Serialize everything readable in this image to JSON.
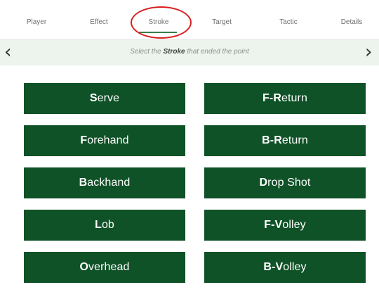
{
  "tabs": [
    {
      "label": "Player"
    },
    {
      "label": "Effect"
    },
    {
      "label": "Stroke"
    },
    {
      "label": "Target"
    },
    {
      "label": "Tactic"
    },
    {
      "label": "Details"
    }
  ],
  "active_tab": "Stroke",
  "instruction": {
    "prefix": "Select the ",
    "emphasis": "Stroke",
    "suffix": " that ended the point"
  },
  "nav": {
    "prev": "‹",
    "next": "›"
  },
  "strokes": [
    {
      "bold": "S",
      "rest": "erve"
    },
    {
      "bold": "F-R",
      "rest": "eturn"
    },
    {
      "bold": "F",
      "rest": "orehand"
    },
    {
      "bold": "B-R",
      "rest": "eturn"
    },
    {
      "bold": "B",
      "rest": "ackhand"
    },
    {
      "bold": "D",
      "rest": "rop Shot"
    },
    {
      "bold": "L",
      "rest": "ob"
    },
    {
      "bold": "F-V",
      "rest": "olley"
    },
    {
      "bold": "O",
      "rest": "verhead"
    },
    {
      "bold": "B-V",
      "rest": "olley"
    }
  ],
  "colors": {
    "button_bg": "#0f5227",
    "accent": "#3b7d4a",
    "highlight_ring": "#d81e1e",
    "instruction_bg": "#edf4ee"
  }
}
